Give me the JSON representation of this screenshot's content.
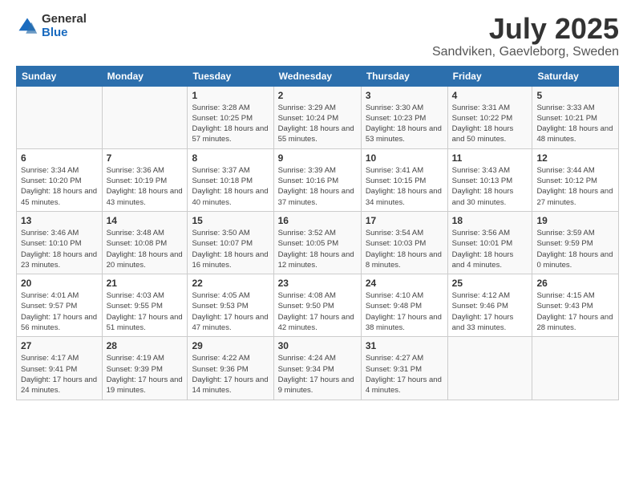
{
  "header": {
    "logo": {
      "general": "General",
      "blue": "Blue"
    },
    "title": "July 2025",
    "subtitle": "Sandviken, Gaevleborg, Sweden"
  },
  "weekdays": [
    "Sunday",
    "Monday",
    "Tuesday",
    "Wednesday",
    "Thursday",
    "Friday",
    "Saturday"
  ],
  "weeks": [
    [
      {
        "day": "",
        "info": ""
      },
      {
        "day": "",
        "info": ""
      },
      {
        "day": "1",
        "info": "Sunrise: 3:28 AM\nSunset: 10:25 PM\nDaylight: 18 hours\nand 57 minutes."
      },
      {
        "day": "2",
        "info": "Sunrise: 3:29 AM\nSunset: 10:24 PM\nDaylight: 18 hours\nand 55 minutes."
      },
      {
        "day": "3",
        "info": "Sunrise: 3:30 AM\nSunset: 10:23 PM\nDaylight: 18 hours\nand 53 minutes."
      },
      {
        "day": "4",
        "info": "Sunrise: 3:31 AM\nSunset: 10:22 PM\nDaylight: 18 hours\nand 50 minutes."
      },
      {
        "day": "5",
        "info": "Sunrise: 3:33 AM\nSunset: 10:21 PM\nDaylight: 18 hours\nand 48 minutes."
      }
    ],
    [
      {
        "day": "6",
        "info": "Sunrise: 3:34 AM\nSunset: 10:20 PM\nDaylight: 18 hours\nand 45 minutes."
      },
      {
        "day": "7",
        "info": "Sunrise: 3:36 AM\nSunset: 10:19 PM\nDaylight: 18 hours\nand 43 minutes."
      },
      {
        "day": "8",
        "info": "Sunrise: 3:37 AM\nSunset: 10:18 PM\nDaylight: 18 hours\nand 40 minutes."
      },
      {
        "day": "9",
        "info": "Sunrise: 3:39 AM\nSunset: 10:16 PM\nDaylight: 18 hours\nand 37 minutes."
      },
      {
        "day": "10",
        "info": "Sunrise: 3:41 AM\nSunset: 10:15 PM\nDaylight: 18 hours\nand 34 minutes."
      },
      {
        "day": "11",
        "info": "Sunrise: 3:43 AM\nSunset: 10:13 PM\nDaylight: 18 hours\nand 30 minutes."
      },
      {
        "day": "12",
        "info": "Sunrise: 3:44 AM\nSunset: 10:12 PM\nDaylight: 18 hours\nand 27 minutes."
      }
    ],
    [
      {
        "day": "13",
        "info": "Sunrise: 3:46 AM\nSunset: 10:10 PM\nDaylight: 18 hours\nand 23 minutes."
      },
      {
        "day": "14",
        "info": "Sunrise: 3:48 AM\nSunset: 10:08 PM\nDaylight: 18 hours\nand 20 minutes."
      },
      {
        "day": "15",
        "info": "Sunrise: 3:50 AM\nSunset: 10:07 PM\nDaylight: 18 hours\nand 16 minutes."
      },
      {
        "day": "16",
        "info": "Sunrise: 3:52 AM\nSunset: 10:05 PM\nDaylight: 18 hours\nand 12 minutes."
      },
      {
        "day": "17",
        "info": "Sunrise: 3:54 AM\nSunset: 10:03 PM\nDaylight: 18 hours\nand 8 minutes."
      },
      {
        "day": "18",
        "info": "Sunrise: 3:56 AM\nSunset: 10:01 PM\nDaylight: 18 hours\nand 4 minutes."
      },
      {
        "day": "19",
        "info": "Sunrise: 3:59 AM\nSunset: 9:59 PM\nDaylight: 18 hours\nand 0 minutes."
      }
    ],
    [
      {
        "day": "20",
        "info": "Sunrise: 4:01 AM\nSunset: 9:57 PM\nDaylight: 17 hours\nand 56 minutes."
      },
      {
        "day": "21",
        "info": "Sunrise: 4:03 AM\nSunset: 9:55 PM\nDaylight: 17 hours\nand 51 minutes."
      },
      {
        "day": "22",
        "info": "Sunrise: 4:05 AM\nSunset: 9:53 PM\nDaylight: 17 hours\nand 47 minutes."
      },
      {
        "day": "23",
        "info": "Sunrise: 4:08 AM\nSunset: 9:50 PM\nDaylight: 17 hours\nand 42 minutes."
      },
      {
        "day": "24",
        "info": "Sunrise: 4:10 AM\nSunset: 9:48 PM\nDaylight: 17 hours\nand 38 minutes."
      },
      {
        "day": "25",
        "info": "Sunrise: 4:12 AM\nSunset: 9:46 PM\nDaylight: 17 hours\nand 33 minutes."
      },
      {
        "day": "26",
        "info": "Sunrise: 4:15 AM\nSunset: 9:43 PM\nDaylight: 17 hours\nand 28 minutes."
      }
    ],
    [
      {
        "day": "27",
        "info": "Sunrise: 4:17 AM\nSunset: 9:41 PM\nDaylight: 17 hours\nand 24 minutes."
      },
      {
        "day": "28",
        "info": "Sunrise: 4:19 AM\nSunset: 9:39 PM\nDaylight: 17 hours\nand 19 minutes."
      },
      {
        "day": "29",
        "info": "Sunrise: 4:22 AM\nSunset: 9:36 PM\nDaylight: 17 hours\nand 14 minutes."
      },
      {
        "day": "30",
        "info": "Sunrise: 4:24 AM\nSunset: 9:34 PM\nDaylight: 17 hours\nand 9 minutes."
      },
      {
        "day": "31",
        "info": "Sunrise: 4:27 AM\nSunset: 9:31 PM\nDaylight: 17 hours\nand 4 minutes."
      },
      {
        "day": "",
        "info": ""
      },
      {
        "day": "",
        "info": ""
      }
    ]
  ]
}
